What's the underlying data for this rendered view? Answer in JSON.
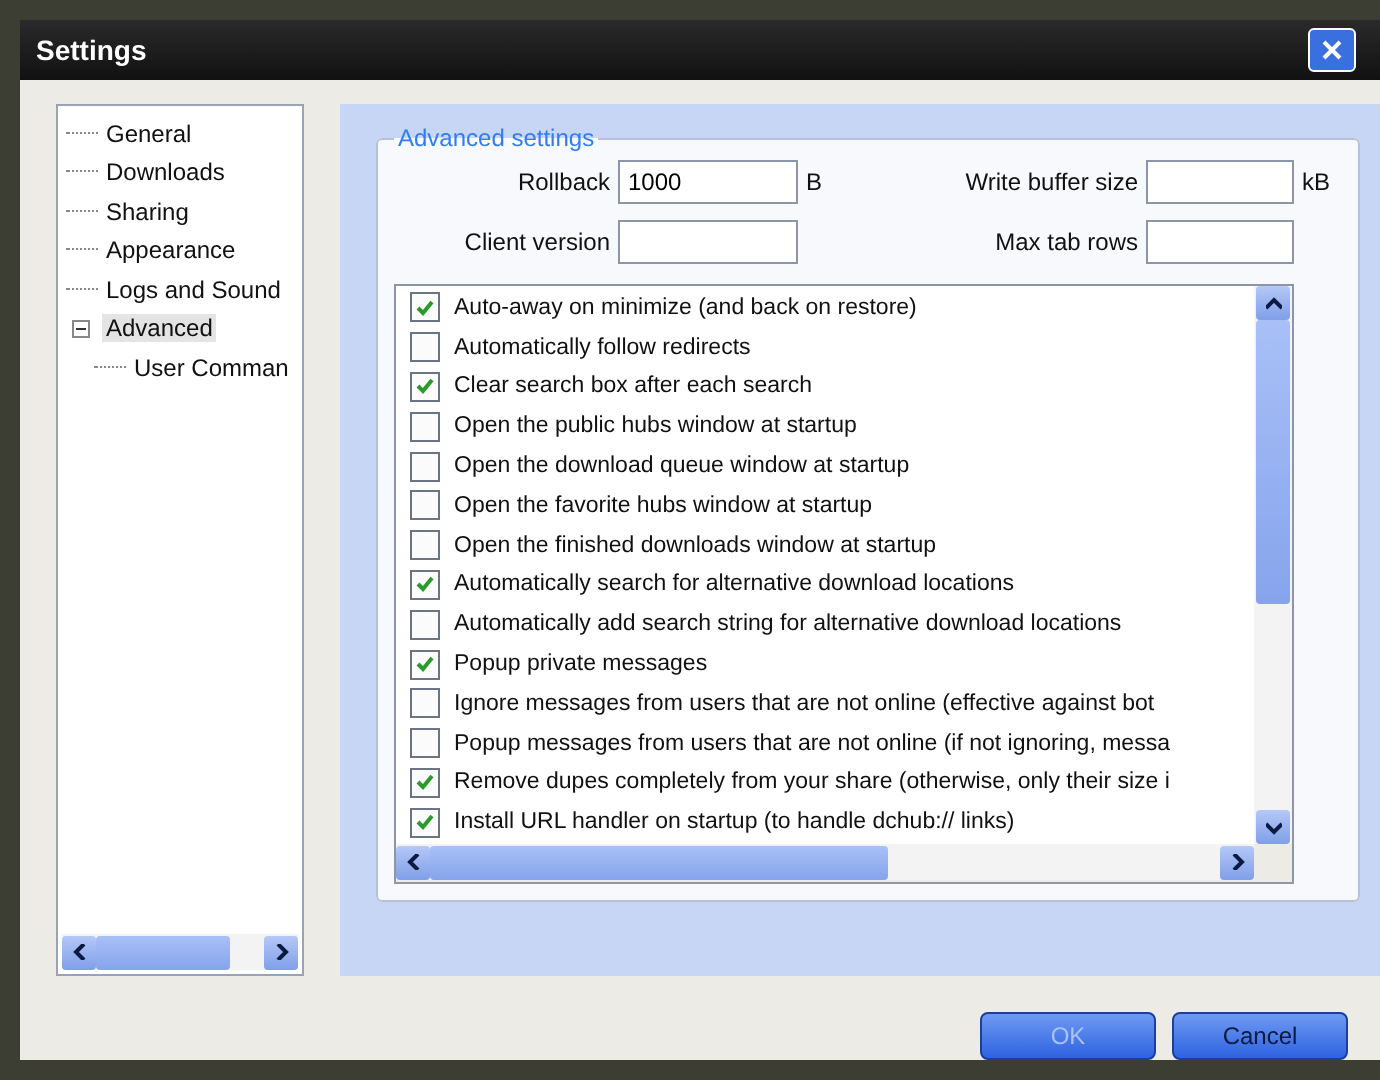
{
  "window": {
    "title": "Settings"
  },
  "tree": [
    {
      "label": "General",
      "selected": false
    },
    {
      "label": "Downloads",
      "selected": false
    },
    {
      "label": "Sharing",
      "selected": false
    },
    {
      "label": "Appearance",
      "selected": false
    },
    {
      "label": "Logs and Sound",
      "selected": false
    },
    {
      "label": "Advanced",
      "selected": true,
      "expanded": true,
      "children": [
        {
          "label": "User Comman",
          "selected": false
        }
      ]
    }
  ],
  "group": {
    "title": "Advanced settings"
  },
  "fields": [
    {
      "label": "Rollback",
      "value": "1000",
      "unit": "B"
    },
    {
      "label": "Write buffer size",
      "unit": "kB"
    },
    {
      "label": "Client version"
    },
    {
      "label": "Max tab rows"
    }
  ],
  "options": [
    {
      "label": "Auto-away on minimize (and back on restore)",
      "checked": true
    },
    {
      "label": "Automatically follow redirects",
      "checked": false
    },
    {
      "label": "Clear search box after each search",
      "checked": true
    },
    {
      "label": "Open the public hubs window at startup",
      "checked": false
    },
    {
      "label": "Open the download queue window at startup",
      "checked": false
    },
    {
      "label": "Open the favorite hubs window at startup",
      "checked": false
    },
    {
      "label": "Open the finished downloads window at startup",
      "checked": false
    },
    {
      "label": "Automatically search for alternative download locations",
      "checked": true
    },
    {
      "label": "Automatically add search string for alternative download locations",
      "checked": false
    },
    {
      "label": "Popup private messages",
      "checked": true
    },
    {
      "label": "Ignore messages from users that are not online (effective against bot",
      "checked": false
    },
    {
      "label": "Popup messages from users that are not online (if not ignoring, messa",
      "checked": false
    },
    {
      "label": "Remove dupes completely from your share (otherwise, only their size i",
      "checked": true
    },
    {
      "label": "Install URL handler on startup (to handle dchub:// links)",
      "checked": true
    }
  ],
  "buttons": [
    {
      "label": "OK",
      "disabled": true
    },
    {
      "label": "Cancel",
      "disabled": false
    }
  ]
}
